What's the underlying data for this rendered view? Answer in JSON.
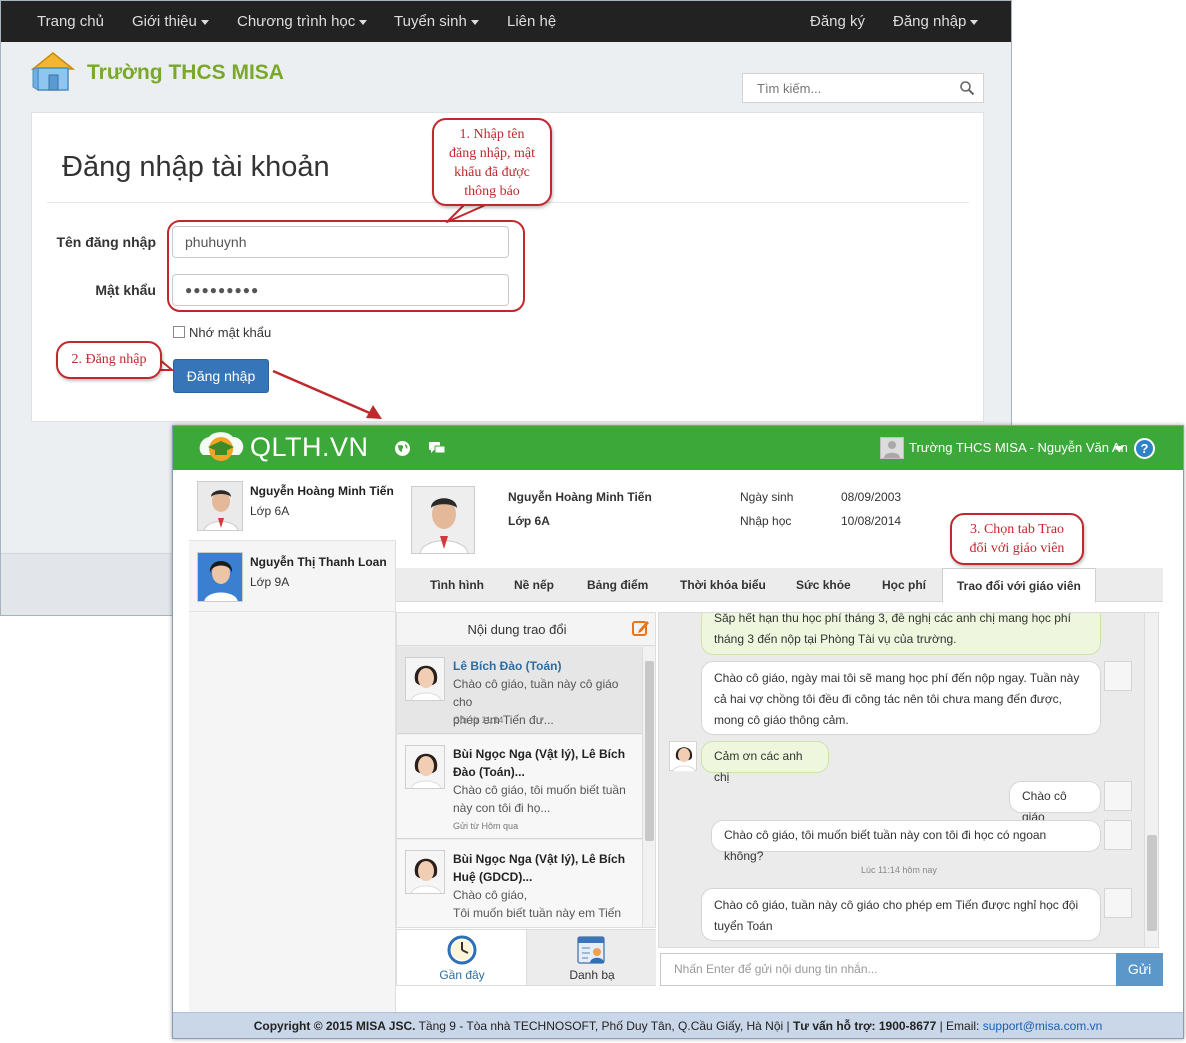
{
  "login_window": {
    "nav": {
      "home": "Trang chủ",
      "about": "Giới thiệu",
      "programs": "Chương trình học",
      "admissions": "Tuyển sinh",
      "contact": "Liên hệ",
      "register": "Đăng ký",
      "login": "Đăng nhập"
    },
    "school_name": "Trường THCS MISA",
    "search_placeholder": "Tìm kiếm...",
    "form": {
      "title": "Đăng nhập tài khoản",
      "username_label": "Tên đăng nhập",
      "username_value": "phuhuynh",
      "password_label": "Mật khẩu",
      "password_value": "●●●●●●●●●",
      "remember_label": "Nhớ mật khẩu",
      "submit_label": "Đăng nhập"
    }
  },
  "callouts": {
    "step1": [
      "1. Nhập tên",
      "đăng nhập, mật",
      "khẩu đã được",
      "thông báo"
    ],
    "step2": "2. Đăng nhập",
    "step3": [
      "3. Chọn tab Trao",
      "đổi với giáo viên"
    ]
  },
  "app": {
    "brand": "QLTH.VN",
    "user_label": "Trường THCS MISA - Nguyễn Văn An",
    "help": "?",
    "students": [
      {
        "name": "Nguyễn Hoàng Minh Tiến",
        "class": "Lớp 6A"
      },
      {
        "name": "Nguyễn Thị Thanh Loan",
        "class": "Lớp 9A"
      }
    ],
    "profile": {
      "name": "Nguyễn Hoàng Minh Tiến",
      "class": "Lớp 6A",
      "dob_label": "Ngày sinh",
      "dob": "08/09/2003",
      "enroll_label": "Nhập học",
      "enroll": "10/08/2014"
    },
    "tabs": [
      "Tình hình",
      "Nề nếp",
      "Bảng điểm",
      "Thời khóa biểu",
      "Sức khỏe",
      "Học phí",
      "Trao đổi với giáo viên"
    ],
    "conversation_list": {
      "title": "Nội dung trao đổi",
      "items": [
        {
          "name": "Lê Bích Đào (Toán)",
          "preview": [
            "Chào cô giáo, tuần này cô giáo cho",
            "phép em Tiến đư..."
          ],
          "time": "Gửi từ 11:14"
        },
        {
          "name": [
            "Bùi Ngọc Nga (Vật lý), Lê Bích",
            "Đào (Toán)..."
          ],
          "preview": [
            "Chào cô giáo, tôi muốn biết tuần",
            "này con tôi đi họ..."
          ],
          "time": "Gửi từ Hôm qua"
        },
        {
          "name": [
            "Bùi Ngọc Nga (Vật lý), Lê Bích",
            "Huệ (GDCD)..."
          ],
          "preview": [
            "Chào cô giáo,",
            "Tôi muốn biết tuần này em Tiến"
          ],
          "time": ""
        }
      ]
    },
    "bottom_tabs": {
      "recent": "Gần đây",
      "contacts": "Danh bạ"
    },
    "messages": [
      {
        "lines": [
          "Sắp hết hạn thu học phí tháng 3, đề nghị các anh chị mang học phí",
          "tháng 3 đến nộp tại Phòng Tài vụ của trường."
        ]
      },
      {
        "lines": [
          "Chào cô giáo, ngày mai tôi sẽ mang học phí đến nộp ngay. Tuần này",
          "cả hai vợ chồng tôi đều đi công tác nên tôi chưa mang đến được,",
          "mong cô giáo thông cảm."
        ]
      },
      {
        "lines": [
          "Cảm ơn các anh chị"
        ]
      },
      {
        "lines": [
          "Chào cô giáo"
        ]
      },
      {
        "lines": [
          "Chào cô giáo, tôi muốn biết tuần này con tôi đi học có ngoan không?"
        ]
      },
      {
        "lines": [
          "Chào cô giáo, tuần này cô giáo cho phép em Tiến được nghỉ học đội",
          "tuyển Toán"
        ]
      }
    ],
    "timestamp": "Lúc 11:14 hôm nay",
    "message_placeholder": "Nhấn Enter để gửi nội dung tin nhắn...",
    "send_label": "Gửi",
    "footer": {
      "copyright": "Copyright © 2015 MISA JSC.",
      "address": " Tầng 9 - Tòa nhà TECHNOSOFT, Phố Duy Tân, Q.Cầu Giấy, Hà Nội | ",
      "hotline": "Tư vấn hỗ trợ: 1900-8677",
      "email_label": " | Email: ",
      "email": "support@misa.com.vn"
    }
  },
  "colors": {
    "app_green": "#3da83a",
    "brand_green": "#7aa82a",
    "callout_red": "#c0282d",
    "button_blue": "#3676b8"
  }
}
